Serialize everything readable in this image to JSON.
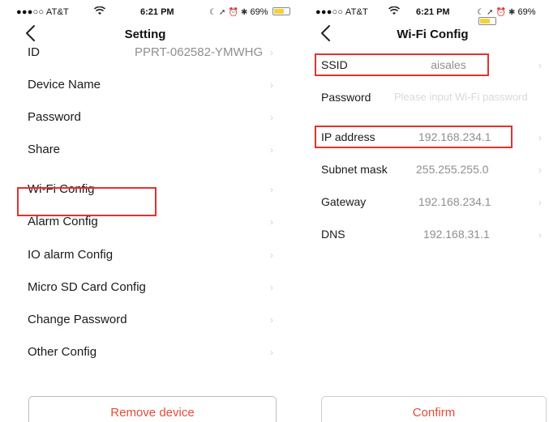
{
  "left": {
    "status": {
      "carrier": "●●●○○ AT&T",
      "time": "6:21 PM",
      "battery_text": "69%",
      "battery_level": 0.69
    },
    "nav": {
      "title": "Setting"
    },
    "rows": [
      {
        "label": "ID",
        "value": "PPRT-062582-YMWHG"
      },
      {
        "label": "Device Name"
      },
      {
        "label": "Password"
      },
      {
        "label": "Share"
      },
      {
        "label": "Wi-Fi Config"
      },
      {
        "label": "Alarm Config"
      },
      {
        "label": "IO alarm Config"
      },
      {
        "label": "Micro SD Card Config"
      },
      {
        "label": "Change Password"
      },
      {
        "label": "Other Config"
      }
    ],
    "button": {
      "label": "Remove device"
    }
  },
  "right": {
    "status": {
      "carrier": "●●●○○ AT&T",
      "time": "6:21 PM",
      "battery_text": "69%",
      "battery_level": 0.69
    },
    "nav": {
      "title": "Wi-Fi Config"
    },
    "rows": [
      {
        "label": "SSID",
        "value": "aisales"
      },
      {
        "label": "Password",
        "placeholder": "Please input Wi-Fi password"
      },
      {
        "label": "IP address",
        "value": "192.168.234.1"
      },
      {
        "label": "Subnet mask",
        "value": "255.255.255.0"
      },
      {
        "label": "Gateway",
        "value": "192.168.234.1"
      },
      {
        "label": "DNS",
        "value": "192.168.31.1"
      }
    ],
    "button": {
      "label": "Confirm"
    }
  },
  "chevron": "›",
  "colors": {
    "highlight": "#e0322f",
    "accent": "#e44b3b",
    "muted": "#8f8f8f"
  },
  "icons": [
    "wifi-icon",
    "moon-icon",
    "location-icon",
    "alarm-icon",
    "bluetooth-icon",
    "battery-icon",
    "back-arrow-icon",
    "chevron-right-icon"
  ]
}
